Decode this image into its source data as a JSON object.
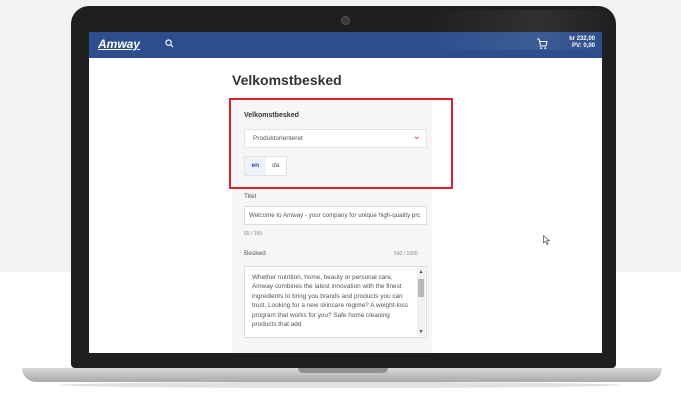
{
  "header": {
    "logo": "Amway",
    "cart": {
      "amount": "kr 232,00",
      "pv": "PV: 0,00"
    }
  },
  "page": {
    "title": "Velkomstbesked"
  },
  "form": {
    "section_label": "Velkomstbesked",
    "dropdown_value": "Produktorienteret",
    "languages": [
      "en",
      "da"
    ],
    "active_language": "en",
    "title_label": "Titel",
    "title_value": "Welcome to Amway - your company for unique high-quality prc",
    "title_counter": "65 / 150",
    "message_label": "Besked",
    "message_counter": "540 / 1000",
    "message_value": "Whether nutrition, home, beauty or personal care, Amway combines the latest innovation with the finest ingredients to bring you brands and products you can trust. Looking for a new skincare regime? A weight-loss program that works for you? Safe home cleaning products that add"
  },
  "colors": {
    "header": "#2c4e8c",
    "highlight": "#e0202a",
    "accent": "#1f4aa0"
  },
  "icons": [
    "search-icon",
    "cart-icon",
    "chevron-down-icon",
    "mouse-pointer-icon"
  ]
}
